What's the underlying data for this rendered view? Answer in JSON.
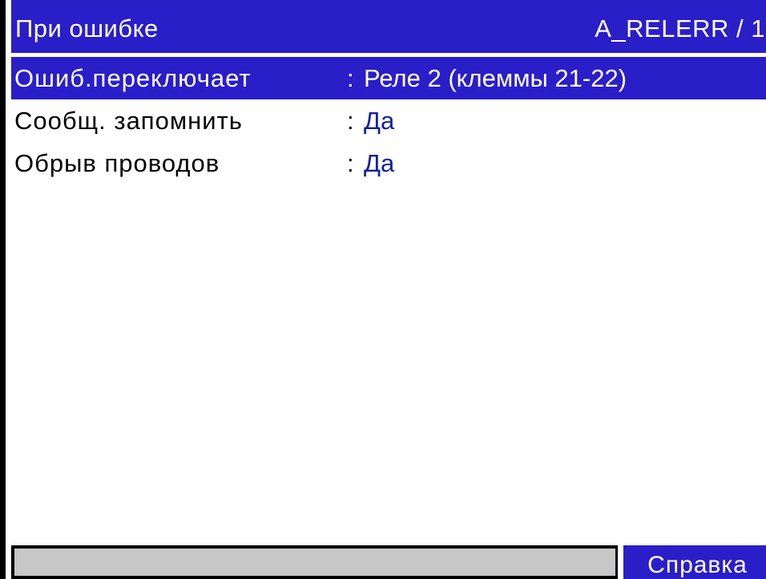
{
  "header": {
    "title": "При ошибке",
    "code": "A_RELERR / 1"
  },
  "settings": [
    {
      "label": "Ошиб.переключает",
      "separator": ":",
      "value": "Реле 2 (клеммы 21-22)",
      "selected": true
    },
    {
      "label": "Сообщ. запомнить",
      "separator": ":",
      "value": "Да",
      "selected": false
    },
    {
      "label": "Обрыв проводов",
      "separator": ":",
      "value": "Да",
      "selected": false
    }
  ],
  "footer": {
    "status_text": "",
    "help_label": "Справка"
  },
  "colors": {
    "accent": "#2a1ec8",
    "value_text": "#1420a0",
    "status_field": "#c8c8c8"
  }
}
